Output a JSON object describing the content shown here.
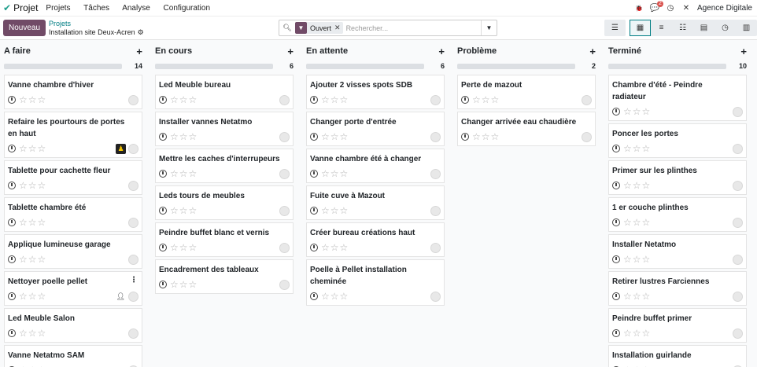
{
  "navbar": {
    "app_name": "Projet",
    "menu": [
      "Projets",
      "Tâches",
      "Analyse",
      "Configuration"
    ],
    "chat_badge": "2",
    "company": "Agence Digitale"
  },
  "control": {
    "new_label": "Nouveau",
    "breadcrumb_parent": "Projets",
    "breadcrumb_current": "Installation site Deux-Acren",
    "facet_label": "Ouvert",
    "search_placeholder": "Rechercher..."
  },
  "columns": [
    {
      "title": "A faire",
      "count": "14",
      "cards": [
        {
          "title": "Vanne chambre d'hiver"
        },
        {
          "title": "Refaire les pourtours de portes en haut",
          "icon": "avatar-icon"
        },
        {
          "title": "Tablette pour cachette fleur"
        },
        {
          "title": "Tablette chambre été"
        },
        {
          "title": "Applique lumineuse garage"
        },
        {
          "title": "Nettoyer poelle pellet",
          "icon": "assign-user-icon",
          "kebab": true
        },
        {
          "title": "Led Meuble Salon"
        },
        {
          "title": "Vanne Netatmo SAM"
        }
      ]
    },
    {
      "title": "En cours",
      "count": "6",
      "cards": [
        {
          "title": "Led Meuble bureau"
        },
        {
          "title": "Installer vannes Netatmo"
        },
        {
          "title": "Mettre les caches d'interrupeurs"
        },
        {
          "title": "Leds tours de meubles"
        },
        {
          "title": "Peindre buffet blanc et vernis"
        },
        {
          "title": "Encadrement des tableaux"
        }
      ]
    },
    {
      "title": "En attente",
      "count": "6",
      "cards": [
        {
          "title": "Ajouter 2 visses spots SDB"
        },
        {
          "title": "Changer porte d'entrée"
        },
        {
          "title": "Vanne chambre été à changer"
        },
        {
          "title": "Fuite cuve à Mazout"
        },
        {
          "title": "Créer bureau créations haut"
        },
        {
          "title": "Poelle à Pellet installation cheminée"
        }
      ]
    },
    {
      "title": "Problème",
      "count": "2",
      "cards": [
        {
          "title": "Perte de mazout"
        },
        {
          "title": "Changer arrivée eau chaudière"
        }
      ]
    },
    {
      "title": "Terminé",
      "count": "10",
      "cards": [
        {
          "title": "Chambre d'été - Peindre radiateur"
        },
        {
          "title": "Poncer les portes"
        },
        {
          "title": "Primer sur les plinthes"
        },
        {
          "title": "1 er couche plinthes"
        },
        {
          "title": "Installer Netatmo"
        },
        {
          "title": "Retirer lustres Farciennes"
        },
        {
          "title": "Peindre buffet primer"
        },
        {
          "title": "Installation guirlande"
        }
      ]
    }
  ]
}
